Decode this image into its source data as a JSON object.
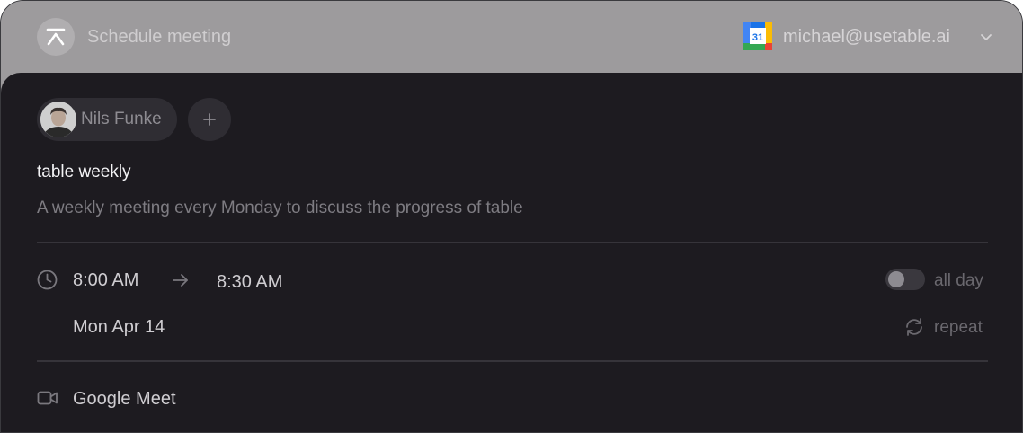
{
  "header": {
    "title": "Schedule meeting",
    "calendar_icon_day": "31",
    "account_email": "michael@usetable.ai"
  },
  "attendees": [
    {
      "name": "Nils Funke"
    }
  ],
  "add_attendee_symbol": "+",
  "event": {
    "title": "table weekly",
    "description": "A weekly meeting every Monday to discuss the progress of table"
  },
  "time": {
    "start": "8:00 AM",
    "end": "8:30 AM",
    "date": "Mon Apr 14",
    "all_day_label": "all day",
    "all_day": false,
    "repeat_label": "repeat"
  },
  "conferencing": {
    "label": "Google Meet"
  },
  "colors": {
    "titlebar": "#9d9b9d",
    "panel": "#1d1b20",
    "chip": "#2f2d33",
    "divider": "#36343a"
  }
}
